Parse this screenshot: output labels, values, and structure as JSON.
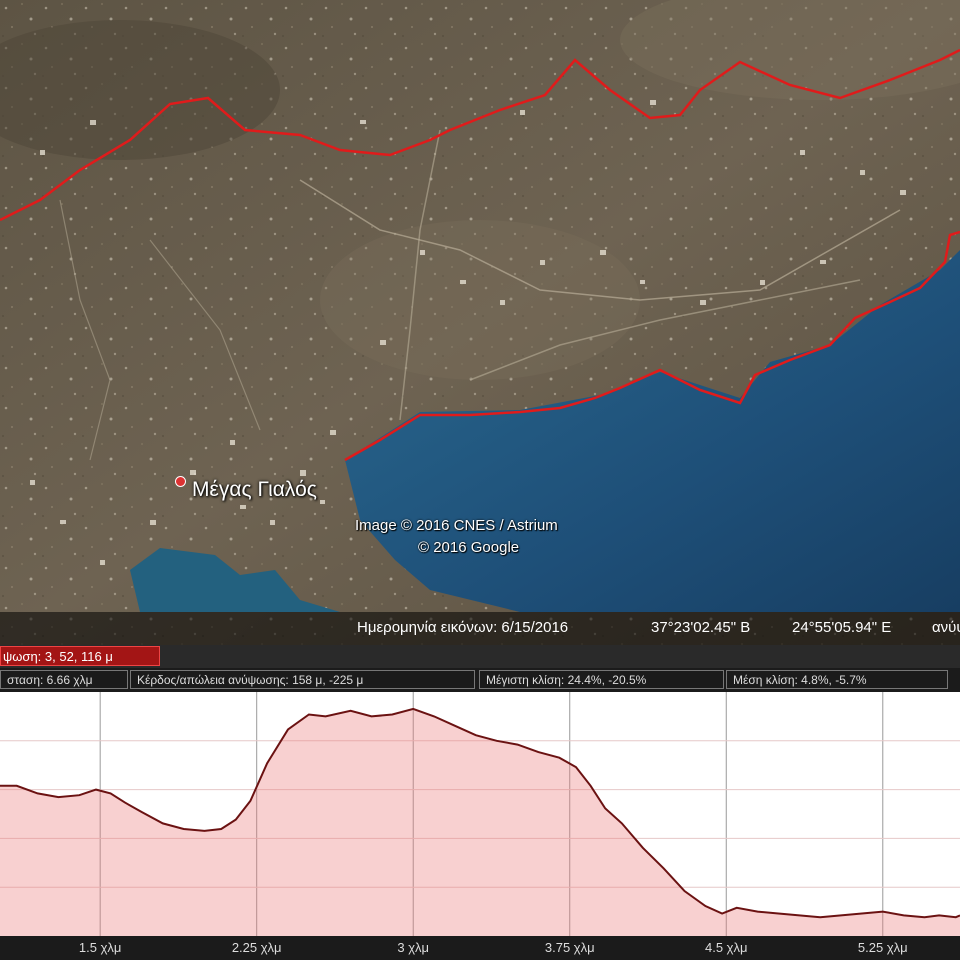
{
  "map": {
    "place_label": "Μέγας Γιαλός",
    "credit_line1": "Image © 2016 CNES / Astrium",
    "credit_line2": "© 2016 Google",
    "status": {
      "imagery_date": "Ημερομηνία εικόνων: 6/15/2016",
      "latitude": "37°23'02.45\" Β",
      "longitude": "24°55'05.94\" Ε",
      "elevation_label": "ανύψ"
    },
    "colors": {
      "track": "#e01b1b",
      "sea": "#1e4f78",
      "land": "#6e6250"
    }
  },
  "profile": {
    "elevation_readout": "ψωση: 3, 52, 116 μ",
    "stats": {
      "distance": "σταση: 6.66 χλμ",
      "gain_loss": "Κέρδος/απώλεια ανύψωσης: 158 μ, -225 μ",
      "max_slope": "Μέγιστη κλίση: 24.4%, -20.5%",
      "avg_slope": "Μέση κλίση: 4.8%, -5.7%"
    }
  },
  "chart_data": {
    "type": "area",
    "xlabel": "",
    "ylabel": "",
    "x_tick_labels": [
      "1.5 χλμ",
      "2.25 χλμ",
      "3 χλμ",
      "3.75 χλμ",
      "4.5 χλμ",
      "5.25 χλμ"
    ],
    "x_ticks": [
      1.5,
      2.25,
      3,
      3.75,
      4.5,
      5.25
    ],
    "xlim": [
      1.02,
      5.62
    ],
    "ylim": [
      0,
      130
    ],
    "series": [
      {
        "x": [
          1.02,
          1.1,
          1.2,
          1.3,
          1.4,
          1.48,
          1.55,
          1.62,
          1.7,
          1.8,
          1.9,
          2.0,
          2.08,
          2.15,
          2.22,
          2.3,
          2.4,
          2.5,
          2.58,
          2.7,
          2.8,
          2.9,
          3.0,
          3.1,
          3.2,
          3.3,
          3.4,
          3.5,
          3.6,
          3.7,
          3.78,
          3.85,
          3.92,
          4.0,
          4.1,
          4.2,
          4.3,
          4.4,
          4.48,
          4.55,
          4.65,
          4.75,
          4.85,
          4.95,
          5.05,
          5.15,
          5.25,
          5.35,
          5.45,
          5.52,
          5.6,
          5.62
        ],
        "y": [
          80,
          80,
          76,
          74,
          75,
          78,
          76,
          71,
          66,
          60,
          57,
          56,
          57,
          62,
          72,
          92,
          110,
          118,
          117,
          120,
          117,
          118,
          121,
          117,
          112,
          107,
          104,
          102,
          98,
          95,
          90,
          80,
          68,
          60,
          47,
          36,
          24,
          16,
          12,
          15,
          13,
          12,
          11,
          10,
          11,
          12,
          13,
          11,
          10,
          11,
          10,
          11
        ]
      }
    ]
  }
}
